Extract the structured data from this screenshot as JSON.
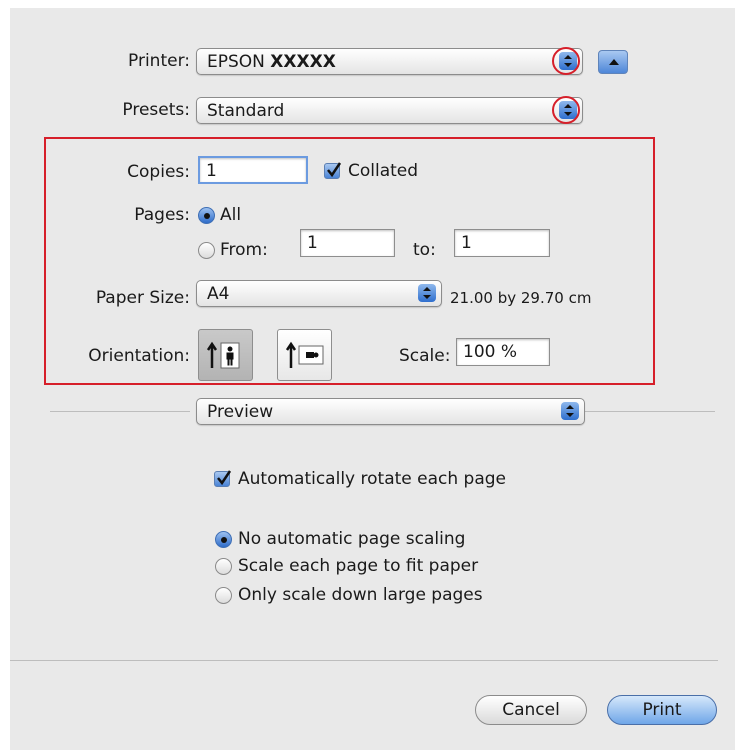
{
  "printer": {
    "label": "Printer:",
    "value_prefix": "EPSON",
    "value_model": "XXXXX"
  },
  "presets": {
    "label": "Presets:",
    "value": "Standard"
  },
  "copies": {
    "label": "Copies:",
    "value": "1",
    "collated_label": "Collated",
    "collated_checked": true
  },
  "pages": {
    "label": "Pages:",
    "all_label": "All",
    "from_label": "From:",
    "from_value": "1",
    "to_label": "to:",
    "to_value": "1",
    "selected": "All"
  },
  "paper_size": {
    "label": "Paper Size:",
    "value": "A4",
    "dimensions": "21.00 by 29.70 cm"
  },
  "orientation": {
    "label": "Orientation:",
    "selected": "portrait"
  },
  "scale": {
    "label": "Scale:",
    "value": "100 %"
  },
  "section_menu": {
    "value": "Preview"
  },
  "preview": {
    "auto_rotate_label": "Automatically rotate each page",
    "auto_rotate_checked": true,
    "scaling_options": [
      {
        "label": "No automatic page scaling",
        "selected": true
      },
      {
        "label": "Scale each page to fit paper",
        "selected": false
      },
      {
        "label": "Only scale down large pages",
        "selected": false
      }
    ]
  },
  "buttons": {
    "cancel": "Cancel",
    "print": "Print"
  },
  "colors": {
    "highlight": "#d61f2a",
    "accent_blue": "#2f6fce",
    "dialog_bg": "#e9e9e9"
  }
}
